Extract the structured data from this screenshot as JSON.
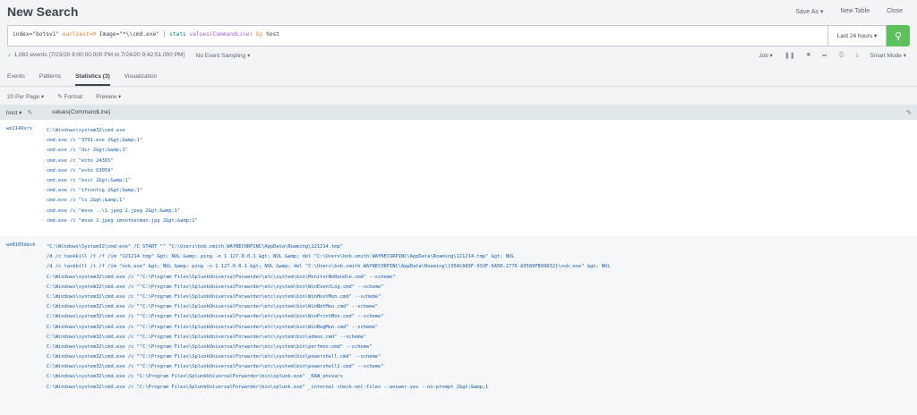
{
  "header": {
    "title": "New Search",
    "save_as": "Save As ▾",
    "new_table": "New Table",
    "close": "Close"
  },
  "search": {
    "query_index": "index=\"botsv1\"",
    "query_earliest": "earliest=0",
    "query_image": "Image=\"*\\\\cmd.exe\"",
    "query_pipe": "|",
    "query_cmd": "stats",
    "query_fn": "values(CommandLine)",
    "query_by": "by",
    "query_host": "host",
    "timerange": "Last 24 hours ▾"
  },
  "status": {
    "events": "1,082 events (7/23/20 9:00:00.000 PM to 7/24/20 9:42:51.000 PM)",
    "sampling": "No Event Sampling ▾",
    "job": "Job ▾",
    "mode": "Smart Mode ▾"
  },
  "tabs": [
    "Events",
    "Patterns",
    "Statistics (3)",
    "Visualization"
  ],
  "toolbar": {
    "per_page": "20 Per Page ▾",
    "format": "✎ Format",
    "preview": "Preview ▾"
  },
  "table": {
    "col_host": "host ▾",
    "col_values": "values(CommandLine)",
    "rows": [
      {
        "host": "we1149srv",
        "values": [
          "C:\\Windows\\system32\\cmd.exe",
          "cmd.exe /c \"3791.exe 2&gt;&amp;1\"",
          "cmd.exe /c \"dir 2&gt;&amp;1\"",
          "cmd.exe /c \"echo 24365\"",
          "cmd.exe /c \"echo 63059\"",
          "cmd.exe /c \"exit 2&gt;&amp;1\"",
          "cmd.exe /c \"ifconfig 2&gt;&amp;1\"",
          "cmd.exe /c \"ls 2&gt;&amp;1\"",
          "cmd.exe /c \"move ..\\1.jpeg 2.jpeg 2&gt;&amp;1\"",
          "cmd.exe /c \"move 2.jpeg imnotbatman.jpg 2&gt;&amp;1\""
        ]
      },
      {
        "host": "we8105desk",
        "values": [
          "\"C:\\Windows\\System32\\cmd.exe\" /C START \"\" \"C:\\Users\\bob.smith.WAYNECORPINC\\AppData\\Roaming\\121214.tmp\"",
          "/d /c taskkill /t /f /im \"121214.tmp\" &gt; NUL &amp; ping -n 1 127.0.0.1 &gt; NUL &amp; del \"C:\\Users\\bob.smith.WAYNECORPINC\\AppData\\Roaming\\121214.tmp\" &gt; NUL",
          "/d /c taskkill /t /f /im \"osk.exe\" &gt; NUL &amp; ping -n 1 127.0.0.1 &gt; NUL &amp; del \"C:\\Users\\bob.smith.WAYNECORPINC\\AppData\\Roaming\\{35ACA89F-933F-6A5D-2776-A3589FB99832}\\osk.exe\" &gt; NUL",
          "C:\\Windows\\system32\\cmd.exe /c \"\"C:\\Program Files\\SplunkUniversalForwarder\\etc\\system\\bin\\MonitorNoHandle.cmd\" --scheme\"",
          "C:\\Windows\\system32\\cmd.exe /c \"\"C:\\Program Files\\SplunkUniversalForwarder\\etc\\system\\bin\\WinEventLog.cmd\" --scheme\"",
          "C:\\Windows\\system32\\cmd.exe /c \"\"C:\\Program Files\\SplunkUniversalForwarder\\etc\\system\\bin\\WinHostMon.cmd\" --scheme\"",
          "C:\\Windows\\system32\\cmd.exe /c \"\"C:\\Program Files\\SplunkUniversalForwarder\\etc\\system\\bin\\WinNetMon.cmd\" --scheme\"",
          "C:\\Windows\\system32\\cmd.exe /c \"\"C:\\Program Files\\SplunkUniversalForwarder\\etc\\system\\bin\\WinPrintMon.cmd\" --scheme\"",
          "C:\\Windows\\system32\\cmd.exe /c \"\"C:\\Program Files\\SplunkUniversalForwarder\\etc\\system\\bin\\WinRegMon.cmd\" --scheme\"",
          "C:\\Windows\\system32\\cmd.exe /c \"\"C:\\Program Files\\SplunkUniversalForwarder\\etc\\system\\bin\\admon.cmd\" --scheme\"",
          "C:\\Windows\\system32\\cmd.exe /c \"\"C:\\Program Files\\SplunkUniversalForwarder\\etc\\system\\bin\\perfmon.cmd\" --scheme\"",
          "C:\\Windows\\system32\\cmd.exe /c \"\"C:\\Program Files\\SplunkUniversalForwarder\\etc\\system\\bin\\powershell.cmd\" --scheme\"",
          "C:\\Windows\\system32\\cmd.exe /c \"\"C:\\Program Files\\SplunkUniversalForwarder\\etc\\system\\bin\\powershell2.cmd\" --scheme\"",
          "C:\\Windows\\system32\\cmd.exe /c \"C:\\Program Files\\SplunkUniversalForwarder\\bin\\splunk.exe\" _RAW_envvars",
          "C:\\Windows\\system32\\cmd.exe /c \"C:\\Program Files\\SplunkUniversalForwarder\\bin\\splunk.exe\" _internal check-xml-files --answer-yes --no-prompt 2&gt;&amp;1"
        ]
      }
    ]
  }
}
